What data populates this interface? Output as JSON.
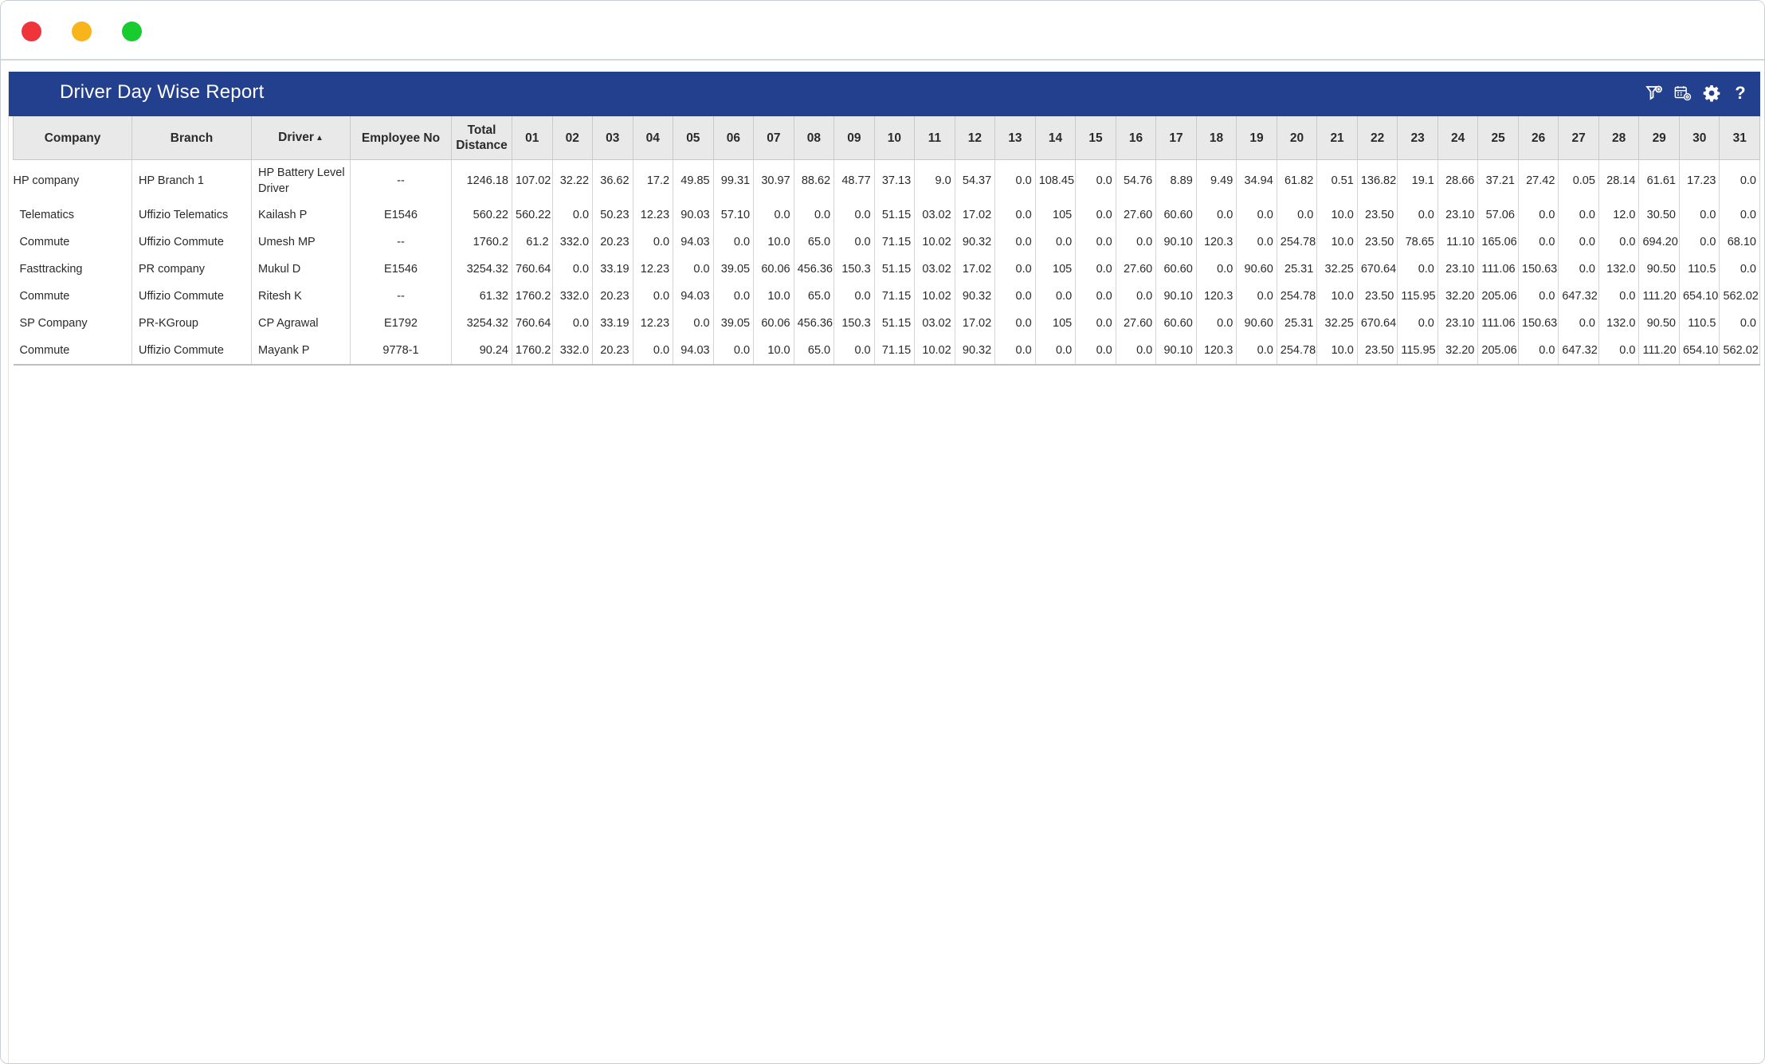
{
  "report": {
    "title": "Driver Day Wise Report"
  },
  "toolbar_icons": [
    "filter-icon",
    "calendar-settings-icon",
    "gear-icon",
    "help-icon"
  ],
  "help_label": "?",
  "sort_indicator": "▲",
  "columns": {
    "company": "Company",
    "branch": "Branch",
    "driver": "Driver",
    "employee_no": "Employee No",
    "total_line1": "Total",
    "total_line2": "Distance",
    "days": [
      "01",
      "02",
      "03",
      "04",
      "05",
      "06",
      "07",
      "08",
      "09",
      "10",
      "11",
      "12",
      "13",
      "14",
      "15",
      "16",
      "17",
      "18",
      "19",
      "20",
      "21",
      "22",
      "23",
      "24",
      "25",
      "26",
      "27",
      "28",
      "29",
      "30",
      "31"
    ]
  },
  "rows": [
    {
      "company": "HP company",
      "branch": "HP Branch 1",
      "driver": "HP Battery Level Driver",
      "employee_no": "--",
      "total": "1246.18",
      "days": [
        "107.02",
        "32.22",
        "36.62",
        "17.2",
        "49.85",
        "99.31",
        "30.97",
        "88.62",
        "48.77",
        "37.13",
        "9.0",
        "54.37",
        "0.0",
        "108.45",
        "0.0",
        "54.76",
        "8.89",
        "9.49",
        "34.94",
        "61.82",
        "0.51",
        "136.82",
        "19.1",
        "28.66",
        "37.21",
        "27.42",
        "0.05",
        "28.14",
        "61.61",
        "17.23",
        "0.0"
      ]
    },
    {
      "company": "Telematics",
      "branch": "Uffizio Telematics",
      "driver": "Kailash P",
      "employee_no": "E1546",
      "total": "560.22",
      "days": [
        "560.22",
        "0.0",
        "50.23",
        "12.23",
        "90.03",
        "57.10",
        "0.0",
        "0.0",
        "0.0",
        "51.15",
        "03.02",
        "17.02",
        "0.0",
        "105",
        "0.0",
        "27.60",
        "60.60",
        "0.0",
        "0.0",
        "0.0",
        "10.0",
        "23.50",
        "0.0",
        "23.10",
        "57.06",
        "0.0",
        "0.0",
        "12.0",
        "30.50",
        "0.0",
        "0.0"
      ]
    },
    {
      "company": "Commute",
      "branch": "Uffizio Commute",
      "driver": "Umesh MP",
      "employee_no": "--",
      "total": "1760.2",
      "days": [
        "61.2",
        "332.0",
        "20.23",
        "0.0",
        "94.03",
        "0.0",
        "10.0",
        "65.0",
        "0.0",
        "71.15",
        "10.02",
        "90.32",
        "0.0",
        "0.0",
        "0.0",
        "0.0",
        "90.10",
        "120.3",
        "0.0",
        "254.78",
        "10.0",
        "23.50",
        "78.65",
        "11.10",
        "165.06",
        "0.0",
        "0.0",
        "0.0",
        "694.20",
        "0.0",
        "68.10"
      ]
    },
    {
      "company": "Fasttracking",
      "branch": "PR company",
      "driver": "Mukul D",
      "employee_no": "E1546",
      "total": "3254.32",
      "days": [
        "760.64",
        "0.0",
        "33.19",
        "12.23",
        "0.0",
        "39.05",
        "60.06",
        "456.36",
        "150.3",
        "51.15",
        "03.02",
        "17.02",
        "0.0",
        "105",
        "0.0",
        "27.60",
        "60.60",
        "0.0",
        "90.60",
        "25.31",
        "32.25",
        "670.64",
        "0.0",
        "23.10",
        "111.06",
        "150.63",
        "0.0",
        "132.0",
        "90.50",
        "110.5",
        "0.0"
      ]
    },
    {
      "company": "Commute",
      "branch": "Uffizio Commute",
      "driver": "Ritesh K",
      "employee_no": "--",
      "total": "61.32",
      "days": [
        "1760.2",
        "332.0",
        "20.23",
        "0.0",
        "94.03",
        "0.0",
        "10.0",
        "65.0",
        "0.0",
        "71.15",
        "10.02",
        "90.32",
        "0.0",
        "0.0",
        "0.0",
        "0.0",
        "90.10",
        "120.3",
        "0.0",
        "254.78",
        "10.0",
        "23.50",
        "115.95",
        "32.20",
        "205.06",
        "0.0",
        "647.32",
        "0.0",
        "111.20",
        "654.10",
        "562.02"
      ]
    },
    {
      "company": "SP Company",
      "branch": "PR-KGroup",
      "driver": "CP Agrawal",
      "employee_no": "E1792",
      "total": "3254.32",
      "days": [
        "760.64",
        "0.0",
        "33.19",
        "12.23",
        "0.0",
        "39.05",
        "60.06",
        "456.36",
        "150.3",
        "51.15",
        "03.02",
        "17.02",
        "0.0",
        "105",
        "0.0",
        "27.60",
        "60.60",
        "0.0",
        "90.60",
        "25.31",
        "32.25",
        "670.64",
        "0.0",
        "23.10",
        "111.06",
        "150.63",
        "0.0",
        "132.0",
        "90.50",
        "110.5",
        "0.0"
      ]
    },
    {
      "company": "Commute",
      "branch": "Uffizio Commute",
      "driver": "Mayank P",
      "employee_no": "9778-1",
      "total": "90.24",
      "days": [
        "1760.2",
        "332.0",
        "20.23",
        "0.0",
        "94.03",
        "0.0",
        "10.0",
        "65.0",
        "0.0",
        "71.15",
        "10.02",
        "90.32",
        "0.0",
        "0.0",
        "0.0",
        "0.0",
        "90.10",
        "120.3",
        "0.0",
        "254.78",
        "10.0",
        "23.50",
        "115.95",
        "32.20",
        "205.06",
        "0.0",
        "647.32",
        "0.0",
        "111.20",
        "654.10",
        "562.02"
      ]
    }
  ]
}
